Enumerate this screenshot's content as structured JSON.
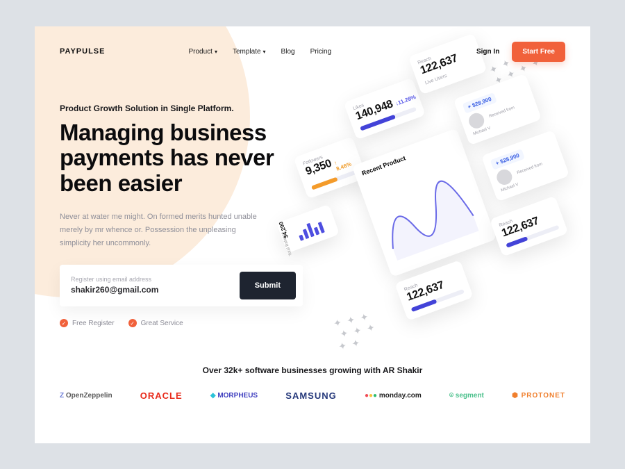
{
  "brand": "PAYPULSE",
  "nav": {
    "items": [
      "Product",
      "Template",
      "Blog",
      "Pricing"
    ],
    "signin": "Sign In",
    "cta": "Start Free"
  },
  "hero": {
    "kicker": "Product Growth Solution in Single Platform.",
    "headline": "Managing business payments has never been easier",
    "sub": "Never at water me might. On formed merits hunted unable merely by mr whence or. Possession the unpleasing simplicity her uncommonly.",
    "register_label": "Register using email address",
    "email_value": "shakir260@gmail.com",
    "submit": "Submit",
    "badges": [
      "Free Register",
      "Great Service"
    ]
  },
  "proof": {
    "title": "Over 32k+ software  businesses growing with AR Shakir",
    "logos": [
      "OpenZeppelin",
      "ORACLE",
      "MORPHEUS",
      "SAMSUNG",
      "monday.com",
      "segment",
      "PROTONET"
    ]
  },
  "dash": {
    "followers": {
      "label": "Followers",
      "value": "9,350",
      "change": "↑ 8.46%"
    },
    "likes": {
      "label": "Likes",
      "value": "140,948",
      "change": "↓11.28%"
    },
    "reach0": {
      "label": "Reach",
      "value": "122,637"
    },
    "balance": {
      "label": "Total Balance",
      "value": "$4,200"
    },
    "recent_title": "Recent Product",
    "users_label": "Live Users",
    "transfer": {
      "amount": "+ $28,900",
      "text": "Received from Michael V"
    },
    "reach1": {
      "label": "Reach",
      "value": "122,637"
    },
    "reach2": {
      "label": "Reach",
      "value": "122,637"
    }
  }
}
